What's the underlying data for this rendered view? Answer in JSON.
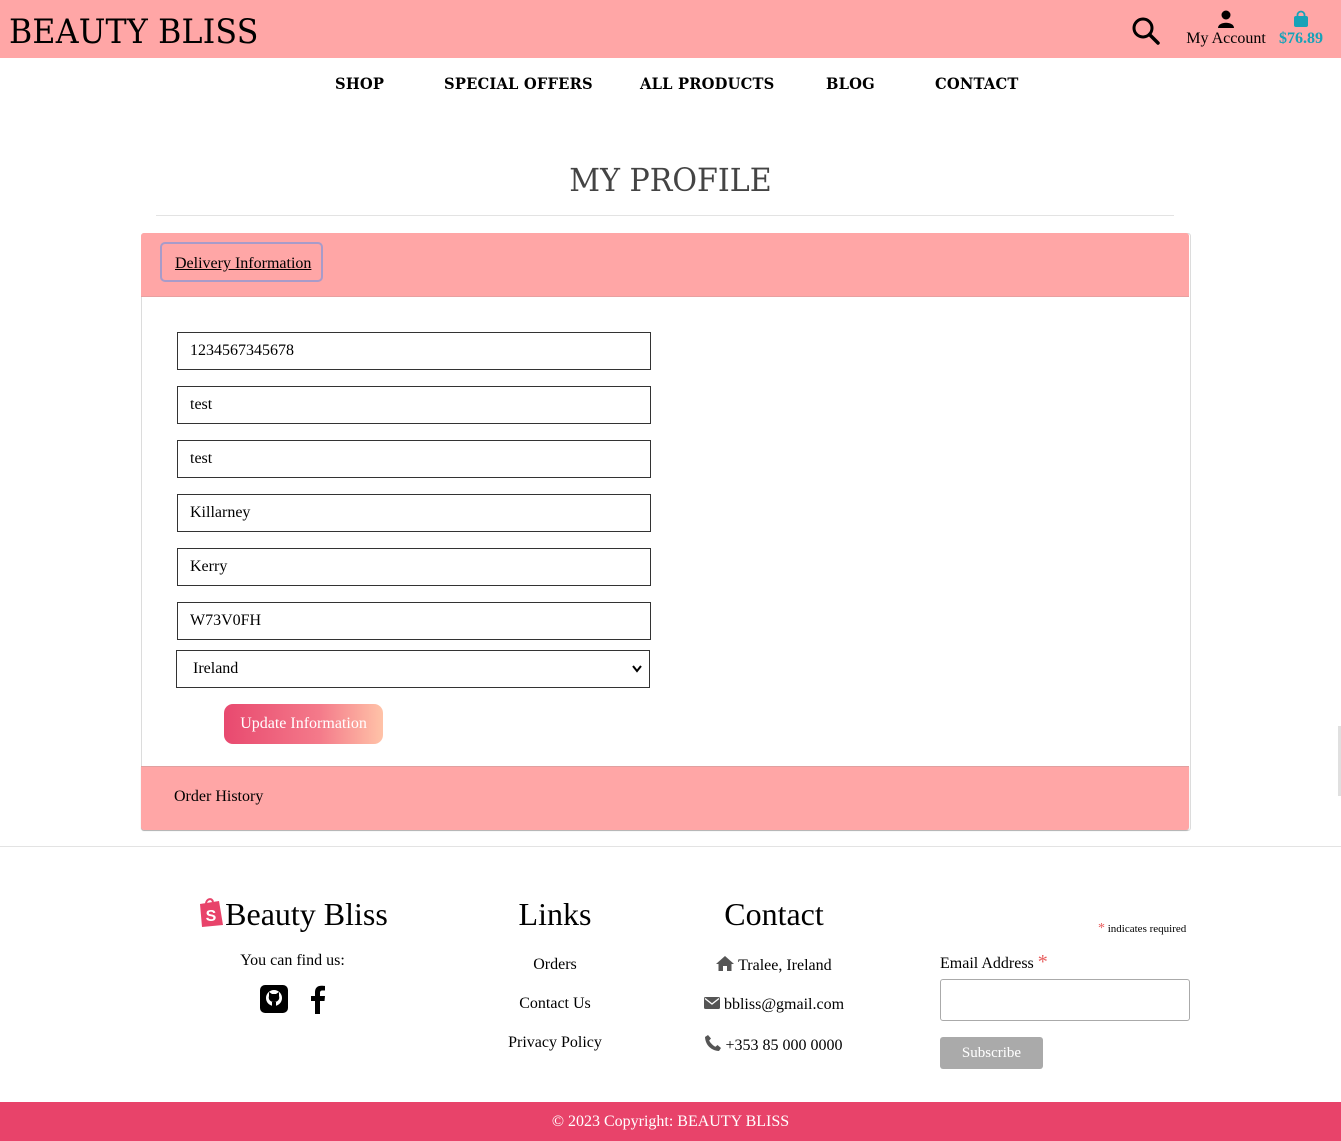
{
  "header": {
    "brand": "BEAUTY BLISS",
    "account_label": "My Account",
    "bag_total": "$76.89"
  },
  "nav": {
    "items": [
      {
        "label": "SHOP"
      },
      {
        "label": "SPECIAL OFFERS"
      },
      {
        "label": "ALL PRODUCTS"
      },
      {
        "label": "BLOG"
      },
      {
        "label": "CONTACT"
      }
    ]
  },
  "page": {
    "title": "MY PROFILE"
  },
  "delivery": {
    "header_label": "Delivery Information",
    "phone": "1234567345678",
    "street1": "test",
    "street2": "test",
    "town": "Killarney",
    "county": "Kerry",
    "postcode": "W73V0FH",
    "country": "Ireland",
    "update_label": "Update Information"
  },
  "orders": {
    "header_label": "Order History"
  },
  "footer": {
    "brand": "Beauty Bliss",
    "find_us": "You can find us:",
    "links_title": "Links",
    "links": [
      {
        "label": "Orders"
      },
      {
        "label": "Contact Us"
      },
      {
        "label": "Privacy Policy"
      }
    ],
    "contact_title": "Contact",
    "address": "Tralee, Ireland",
    "email": "bbliss@gmail.com",
    "phone": "+353 85 000 0000",
    "required_note": "indicates required",
    "required_star": "*",
    "email_label": "Email Address",
    "subscribe_label": "Subscribe",
    "copyright": "© 2023 Copyright: BEAUTY BLISS"
  },
  "colors": {
    "header_bg": "#ffa6a6",
    "accent": "#e8436a",
    "bag_total": "#17a2b8"
  },
  "icons": [
    "search-icon",
    "user-icon",
    "shopping-bag-icon",
    "shopify-icon",
    "github-icon",
    "facebook-icon",
    "home-icon",
    "envelope-icon",
    "phone-icon",
    "chevron-down-icon"
  ]
}
